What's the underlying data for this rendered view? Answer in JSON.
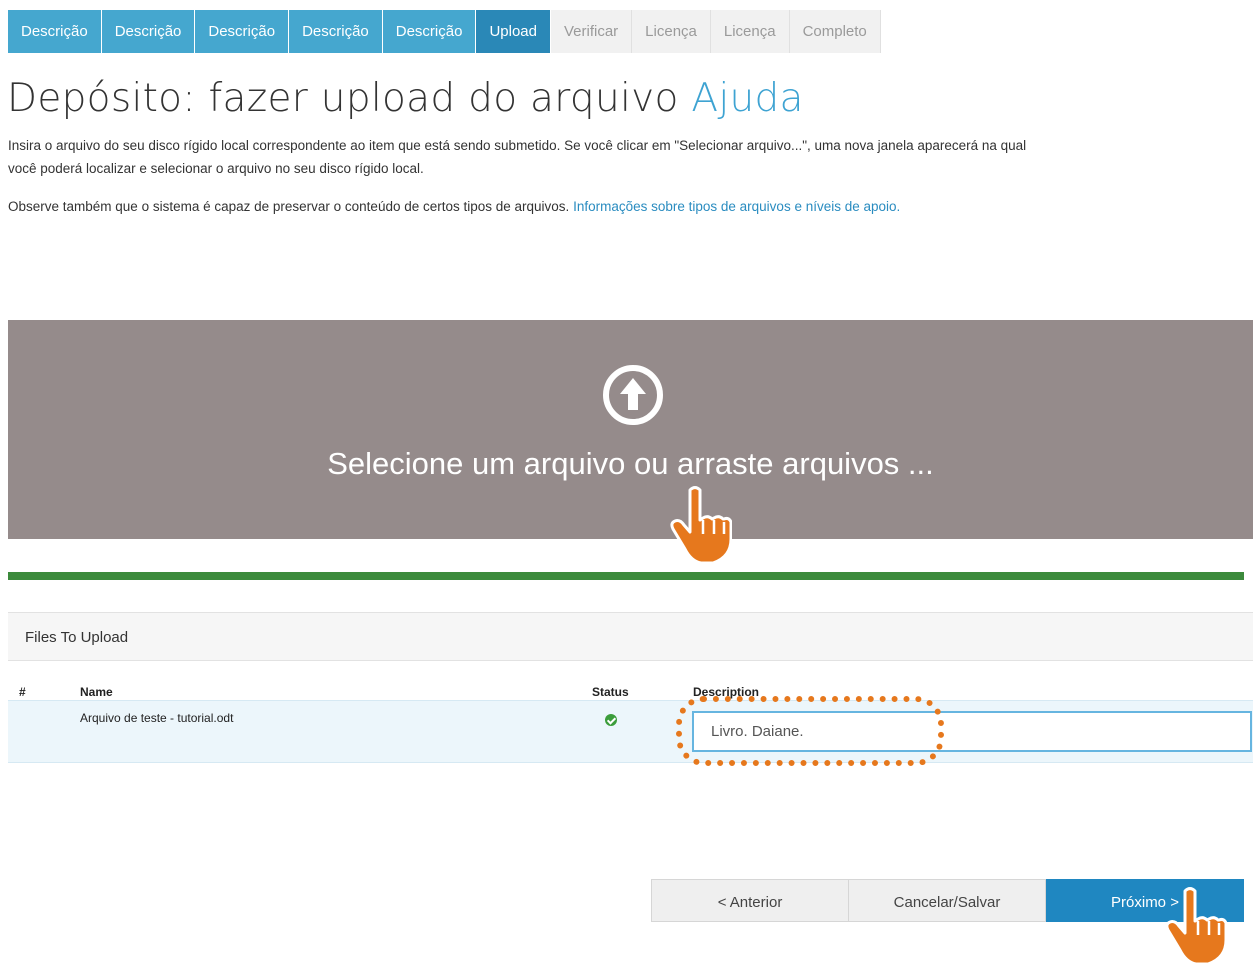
{
  "steps": [
    {
      "label": "Descrição",
      "state": "done"
    },
    {
      "label": "Descrição",
      "state": "done"
    },
    {
      "label": "Descrição",
      "state": "done"
    },
    {
      "label": "Descrição",
      "state": "done"
    },
    {
      "label": "Descrição",
      "state": "done"
    },
    {
      "label": "Upload",
      "state": "current"
    },
    {
      "label": "Verificar",
      "state": "todo"
    },
    {
      "label": "Licença",
      "state": "todo"
    },
    {
      "label": "Licença",
      "state": "todo"
    },
    {
      "label": "Completo",
      "state": "todo"
    }
  ],
  "page": {
    "title": "Depósito: fazer upload do arquivo",
    "help_link": "Ajuda",
    "intro_line1": "Insira o arquivo do seu disco rígido local correspondente ao item que está sendo submetido. Se você clicar em \"Selecionar arquivo...\", uma nova janela aparecerá na qual",
    "intro_line2": "você poderá localizar e selecionar o arquivo no seu disco rígido local.",
    "note_text": "Observe também que o sistema é capaz de preservar o conteúdo de certos tipos de arquivos.",
    "note_link": "Informações sobre tipos de arquivos e níveis de apoio."
  },
  "dropzone": {
    "text": "Selecione um arquivo ou arraste arquivos ...",
    "icon": "upload-arrow-circle-icon"
  },
  "upload_progress": 1.0,
  "files": {
    "heading": "Files To Upload",
    "columns": {
      "num": "#",
      "name": "Name",
      "status": "Status",
      "description": "Description"
    },
    "rows": [
      {
        "name": "Arquivo de teste - tutorial.odt",
        "status": "ok",
        "description": "Livro. Daiane."
      }
    ]
  },
  "buttons": {
    "previous": "< Anterior",
    "cancel_save": "Cancelar/Salvar",
    "next": "Próximo >"
  },
  "colors": {
    "step_done": "#45a7cf",
    "step_current": "#2a88b7",
    "dropzone_bg": "#958b8b",
    "progress_bar": "#3c8a3c",
    "annotation_orange": "#e6781d",
    "next_button": "#1f87c1"
  }
}
